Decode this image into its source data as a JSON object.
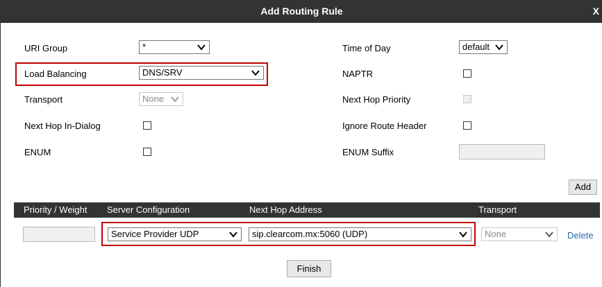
{
  "dialog": {
    "title": "Add Routing Rule",
    "close_label": "X"
  },
  "form": {
    "left": {
      "uri_group": {
        "label": "URI Group",
        "value": "*"
      },
      "load_balancing": {
        "label": "Load Balancing",
        "value": "DNS/SRV"
      },
      "transport": {
        "label": "Transport",
        "value": "None"
      },
      "next_hop_in_dialog": {
        "label": "Next Hop In-Dialog",
        "checked": false
      },
      "enum": {
        "label": "ENUM",
        "checked": false
      }
    },
    "right": {
      "time_of_day": {
        "label": "Time of Day",
        "value": "default"
      },
      "naptr": {
        "label": "NAPTR",
        "checked": false
      },
      "next_hop_priority": {
        "label": "Next Hop Priority",
        "checked": false
      },
      "ignore_route_header": {
        "label": "Ignore Route Header",
        "checked": false
      },
      "enum_suffix": {
        "label": "ENUM Suffix",
        "value": ""
      }
    }
  },
  "add_button": {
    "label": "Add"
  },
  "table": {
    "headers": [
      "Priority / Weight",
      "Server Configuration",
      "Next Hop Address",
      "Transport"
    ],
    "row": {
      "priority_weight": "",
      "server_configuration": "Service Provider UDP",
      "next_hop_address": "sip.clearcom.mx:5060 (UDP)",
      "transport": "None",
      "delete_label": "Delete"
    }
  },
  "finish_button": {
    "label": "Finish"
  },
  "colors": {
    "header_bg": "#333333",
    "highlight": "#c00000",
    "link": "#2a68b0"
  }
}
